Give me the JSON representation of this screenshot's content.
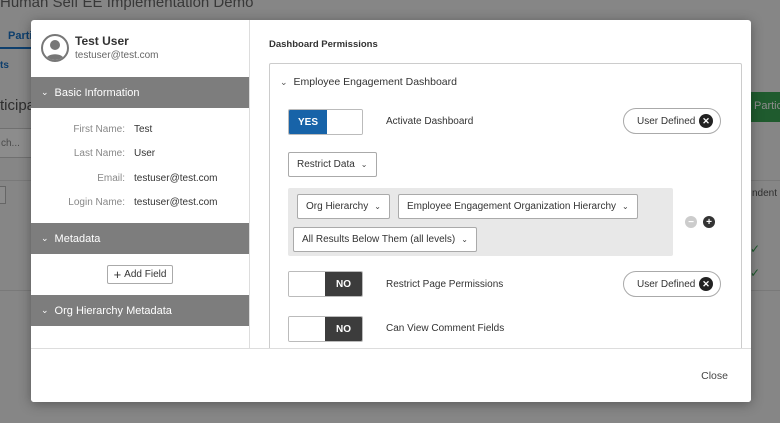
{
  "background": {
    "title": "Human Self EE Implementation Demo",
    "tab": "Parti",
    "subtab": "ts",
    "heading": "ticipa",
    "search_text": "ch...",
    "button": "Partic",
    "column": "ndent"
  },
  "modal": {
    "user": {
      "name": "Test User",
      "email": "testuser@test.com"
    },
    "sections": {
      "basic_info": "Basic Information",
      "metadata": "Metadata",
      "org_hierarchy_metadata": "Org Hierarchy Metadata"
    },
    "fields": [
      {
        "label": "First Name:",
        "value": "Test"
      },
      {
        "label": "Last Name:",
        "value": "User"
      },
      {
        "label": "Email:",
        "value": "testuser@test.com"
      },
      {
        "label": "Login Name:",
        "value": "testuser@test.com"
      }
    ],
    "add_field_label": "Add Field",
    "permissions": {
      "title": "Dashboard Permissions",
      "dashboard_name": "Employee Engagement Dashboard",
      "activate": {
        "toggle": "YES",
        "label": "Activate Dashboard",
        "pill": "User Defined"
      },
      "restrict_data": "Restrict Data",
      "filter": {
        "hierarchy": "Org Hierarchy",
        "hierarchy_value": "Employee Engagement Organization Hierarchy",
        "scope": "All Results Below Them (all levels)"
      },
      "restrict_page": {
        "toggle": "NO",
        "label": "Restrict Page Permissions",
        "pill": "User Defined"
      },
      "comment_fields": {
        "toggle": "NO",
        "label": "Can View Comment Fields"
      }
    },
    "close_label": "Close"
  }
}
